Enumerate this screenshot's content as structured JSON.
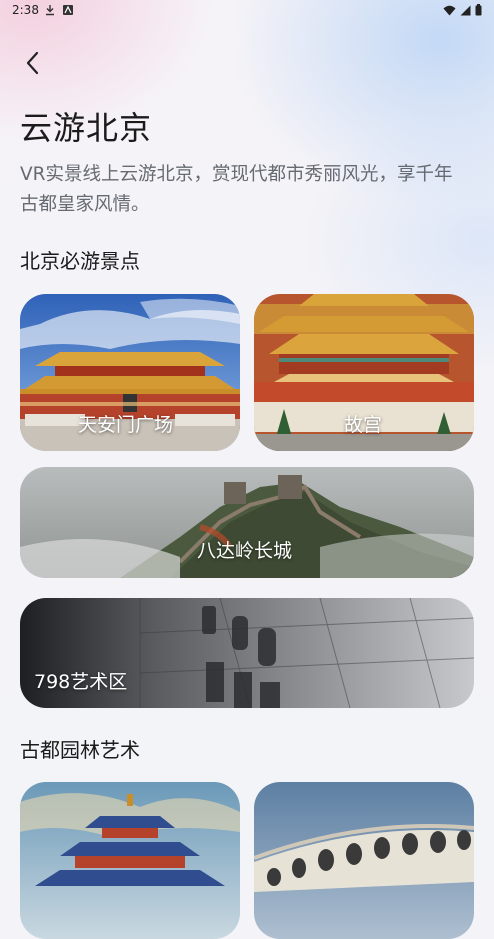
{
  "status": {
    "time": "2:38"
  },
  "header": {
    "title": "云游北京",
    "description": "VR实景线上云游北京，赏现代都市秀丽风光，享千年古都皇家风情。"
  },
  "sections": [
    {
      "title": "北京必游景点"
    },
    {
      "title": "古都园林艺术"
    }
  ],
  "spots": [
    {
      "label": "天安门广场"
    },
    {
      "label": "故宫"
    },
    {
      "label": "八达岭长城"
    },
    {
      "label": "798艺术区"
    }
  ],
  "colors": {
    "accent_gate_red": "#b5432c",
    "roof_yellow": "#d9a53a",
    "text_primary": "#1b1b1b",
    "text_secondary": "#666a72"
  },
  "icons": [
    "download-icon",
    "app-icon",
    "wifi-icon",
    "signal-icon",
    "battery-icon",
    "back-arrow-icon"
  ]
}
